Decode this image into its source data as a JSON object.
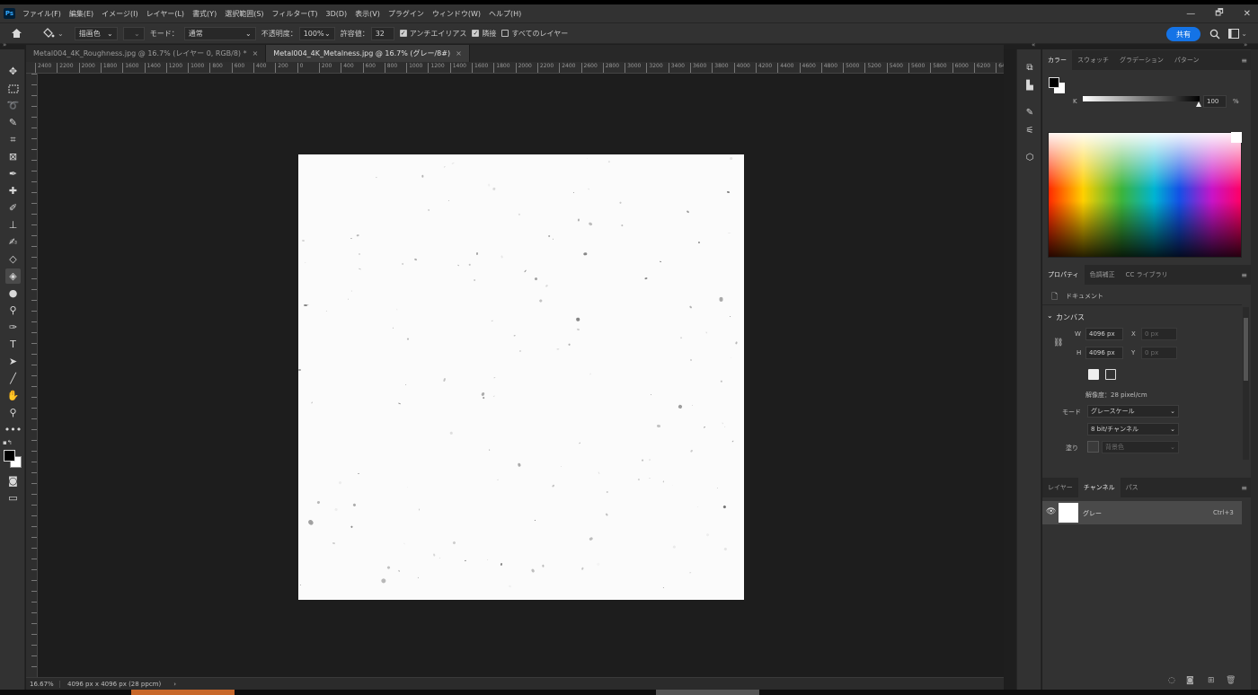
{
  "menubar": {
    "logo": "Ps",
    "items": [
      "ファイル(F)",
      "編集(E)",
      "イメージ(I)",
      "レイヤー(L)",
      "書式(Y)",
      "選択範囲(S)",
      "フィルター(T)",
      "3D(D)",
      "表示(V)",
      "プラグイン",
      "ウィンドウ(W)",
      "ヘルプ(H)"
    ],
    "window_controls": [
      "—",
      "🗗",
      "✕"
    ]
  },
  "options": {
    "fill_source": "描画色",
    "mode_label": "モード：",
    "mode_value": "通常",
    "opacity_label": "不透明度：",
    "opacity_value": "100%",
    "tolerance_label": "許容値：",
    "tolerance_value": "32",
    "antialias_label": "アンチエイリアス",
    "antialias_checked": true,
    "contiguous_label": "隣接",
    "contiguous_checked": true,
    "all_layers_label": "すべてのレイヤー",
    "all_layers_checked": false,
    "share_label": "共有"
  },
  "doc_tabs": [
    {
      "title": "Metal004_4K_Roughness.jpg @ 16.7% (レイヤー 0, RGB/8) *",
      "active": false
    },
    {
      "title": "Metal004_4K_Metalness.jpg @ 16.7% (グレー/8#)",
      "active": true
    }
  ],
  "ruler": {
    "h_ticks": [
      "2400",
      "2200",
      "2000",
      "1800",
      "1600",
      "1400",
      "1200",
      "1000",
      "800",
      "600",
      "400",
      "200",
      "0",
      "200",
      "400",
      "600",
      "800",
      "1000",
      "1200",
      "1400",
      "1600",
      "1800",
      "2000",
      "2200",
      "2400",
      "2600",
      "2800",
      "3000",
      "3200",
      "3400",
      "3600",
      "3800",
      "4000",
      "4200",
      "4400",
      "4600",
      "4800",
      "5000",
      "5200",
      "5400",
      "5600",
      "5800",
      "6000",
      "6200",
      "64"
    ]
  },
  "status": {
    "zoom": "16.67%",
    "doc_info": "4096 px x 4096 px (28 ppcm)",
    "arrow": "›"
  },
  "color_panel": {
    "tabs": [
      "カラー",
      "スウォッチ",
      "グラデーション",
      "パターン"
    ],
    "channel_label": "K",
    "value": "100",
    "unit": "%"
  },
  "properties_panel": {
    "tabs": [
      "プロパティ",
      "色調補正",
      "CC ライブラリ"
    ],
    "doc_label": "ドキュメント",
    "section": "カンバス",
    "w_label": "W",
    "w_value": "4096 px",
    "h_label": "H",
    "h_value": "4096 px",
    "x_label": "X",
    "x_value": "0 px",
    "y_label": "Y",
    "y_value": "0 px",
    "resolution": "解像度：28 pixel/cm",
    "mode_label": "モード",
    "mode_value": "グレースケール",
    "bits_value": "8 bit/チャンネル",
    "fill_label": "塗り",
    "fill_value": "背景色"
  },
  "layers_panel": {
    "tabs": [
      "レイヤー",
      "チャンネル",
      "パス"
    ],
    "channel_name": "グレー",
    "shortcut": "Ctrl+3"
  },
  "tool_icons": [
    "move-icon",
    "marquee-icon",
    "lasso-icon",
    "magic-wand-icon",
    "crop-icon",
    "frame-icon",
    "eyedropper-icon",
    "healing-brush-icon",
    "brush-icon",
    "clone-stamp-icon",
    "history-brush-icon",
    "eraser-icon",
    "paint-bucket-icon",
    "blur-icon",
    "dodge-icon",
    "pen-icon",
    "type-icon",
    "path-selection-icon",
    "line-icon",
    "hand-icon",
    "zoom-icon",
    "more-tools-icon"
  ]
}
